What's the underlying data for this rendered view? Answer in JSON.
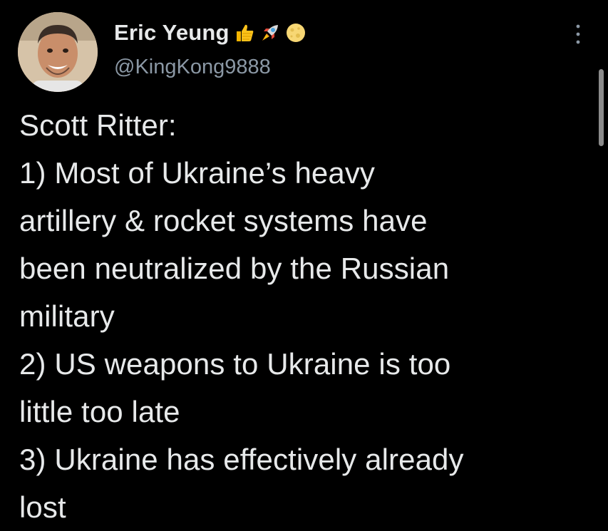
{
  "author": {
    "display_name": "Eric Yeung",
    "handle": "@KingKong9888",
    "badges": [
      "thumbs-up-icon",
      "rocket-icon",
      "moon-icon"
    ]
  },
  "tweet": {
    "lines": [
      "Scott Ritter:",
      "1) Most of Ukraine’s heavy",
      "artillery & rocket systems have",
      "been neutralized by the Russian",
      "military",
      "2) US weapons to Ukraine is too",
      "little too late",
      "3) Ukraine has effectively already",
      "lost"
    ]
  },
  "colors": {
    "background": "#000000",
    "text_primary": "#e7e9ea",
    "text_secondary": "#8b98a5"
  }
}
